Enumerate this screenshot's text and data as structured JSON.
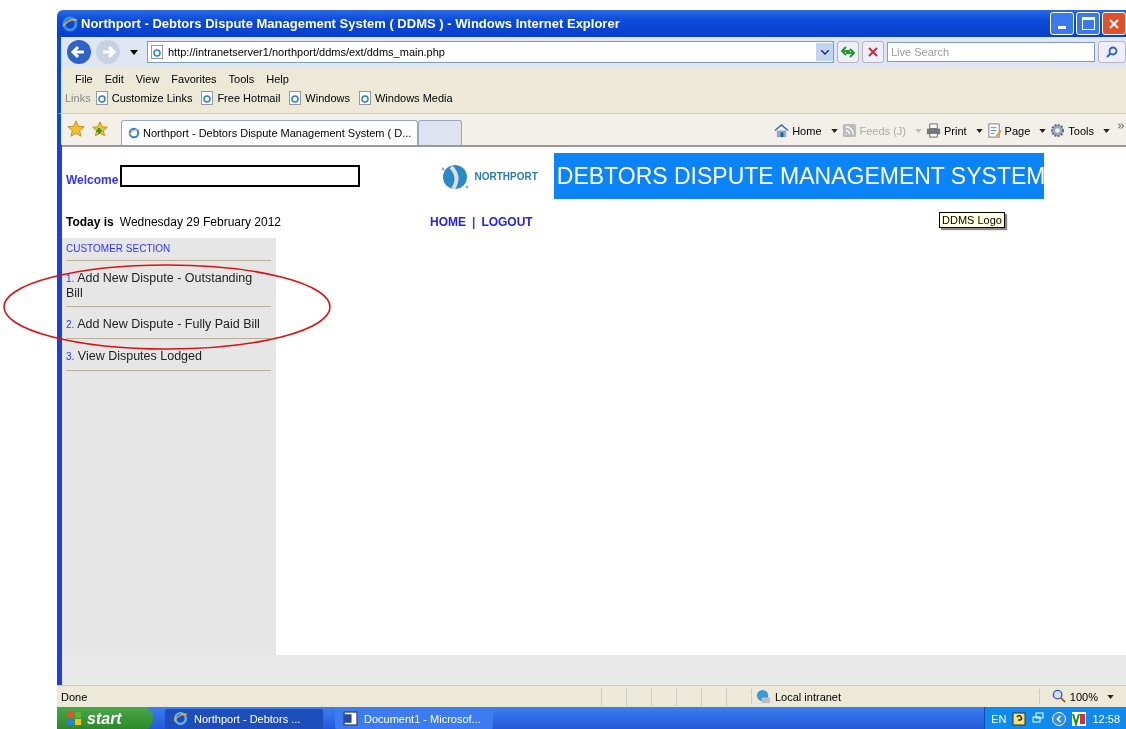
{
  "window": {
    "title": "Northport - Debtors Dispute Management System ( DDMS ) - Windows Internet Explorer"
  },
  "address_bar": {
    "url": "http://intranetserver1/northport/ddms/ext/ddms_main.php",
    "search_placeholder": "Live Search"
  },
  "menu": [
    "File",
    "Edit",
    "View",
    "Favorites",
    "Tools",
    "Help"
  ],
  "links_bar": {
    "label": "Links",
    "items": [
      "Customize Links",
      "Free Hotmail",
      "Windows",
      "Windows Media"
    ]
  },
  "tabs": [
    {
      "label": "Northport - Debtors Dispute Management System ( D...",
      "selected": true
    },
    {
      "selected": false
    }
  ],
  "command_bar": [
    {
      "kind": "home",
      "label": "Home",
      "disabled": false
    },
    {
      "kind": "feeds",
      "label": "Feeds (J)",
      "disabled": true
    },
    {
      "kind": "print",
      "label": "Print",
      "disabled": false
    },
    {
      "kind": "page",
      "label": "Page",
      "disabled": false
    },
    {
      "kind": "tools",
      "label": "Tools",
      "disabled": false
    }
  ],
  "page": {
    "welcome_label": "Welcome",
    "logo_text": "NORTHPORT",
    "banner": "DEBTORS DISPUTE MANAGEMENT SYSTEM",
    "tooltip": "DDMS Logo",
    "today_label": "Today is",
    "date": "Wednesday 29 February 2012",
    "nav_links": [
      "HOME",
      "LOGOUT"
    ],
    "nav_separator": "|",
    "sidebar": {
      "heading": "CUSTOMER SECTION",
      "items": [
        {
          "number": "1.",
          "label": "Add New Dispute - Outstanding Bill"
        },
        {
          "number": "2.",
          "label": "Add New Dispute - Fully Paid Bill"
        },
        {
          "number": "3.",
          "label": "View Disputes Lodged"
        }
      ]
    }
  },
  "status_bar": {
    "text": "Done",
    "zone": "Local intranet",
    "zoom": "100%"
  },
  "taskbar": {
    "start": "start",
    "tasks": [
      {
        "label": "Northport - Debtors ...",
        "kind": "browser",
        "selected": true
      },
      {
        "label": "Document1 - Microsof...",
        "kind": "word",
        "selected": false
      }
    ],
    "language": "EN",
    "time": "12:58"
  }
}
